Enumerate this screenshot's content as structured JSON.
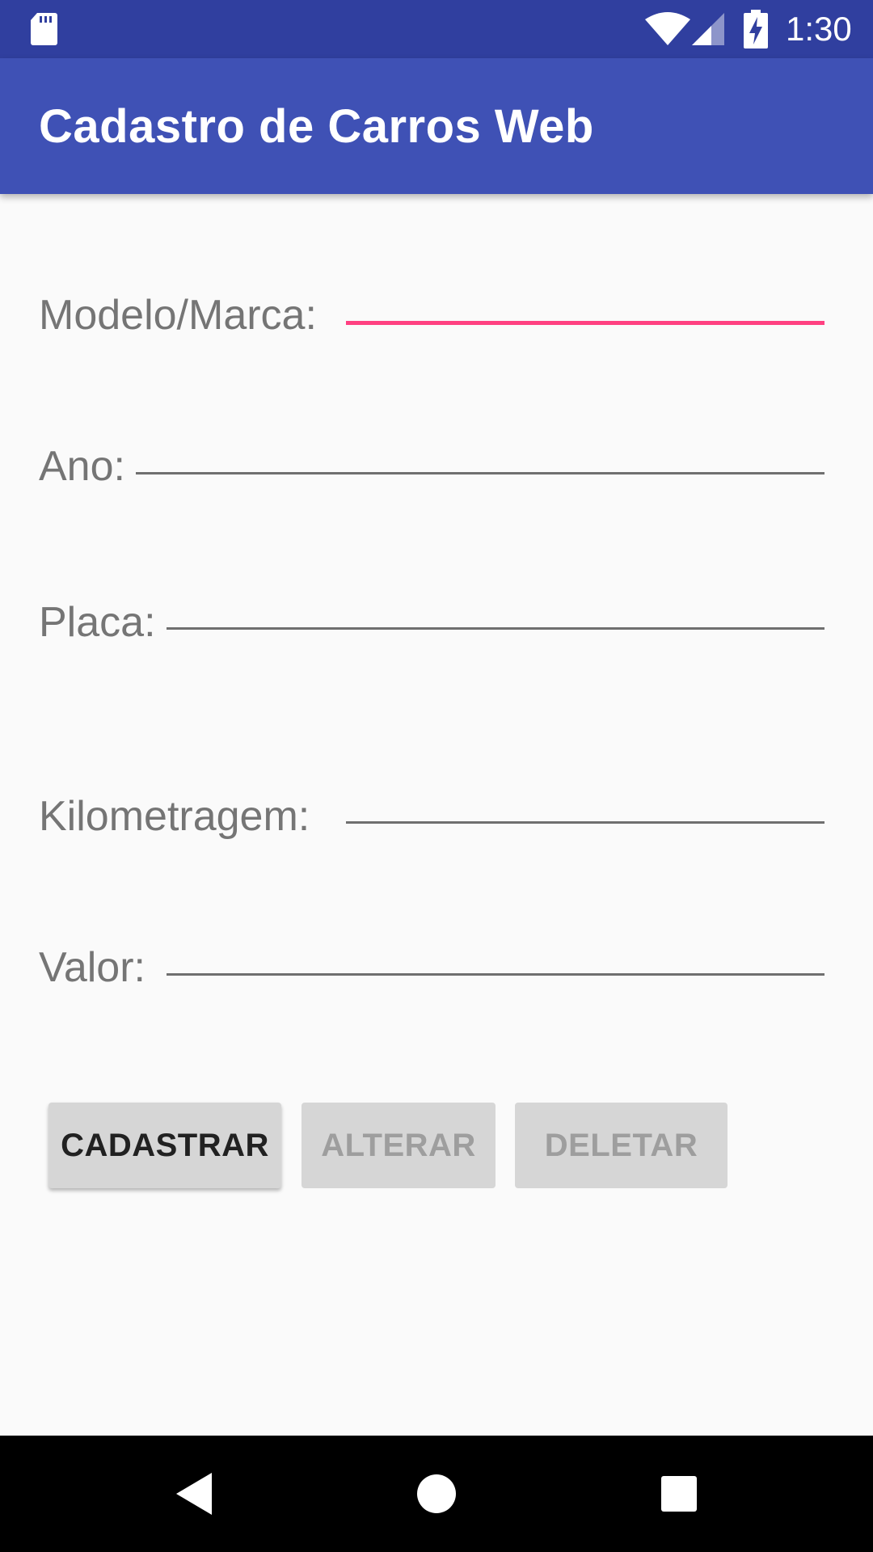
{
  "status_bar": {
    "time": "1:30",
    "icons": [
      "sd-card-icon",
      "wifi-icon",
      "cell-signal-icon",
      "battery-charging-icon"
    ]
  },
  "app_bar": {
    "title": "Cadastro de Carros Web"
  },
  "form": {
    "modelo_label": "Modelo/Marca:",
    "modelo_value": "",
    "ano_label": "Ano:",
    "ano_value": "",
    "placa_label": "Placa:",
    "placa_value": "",
    "km_label": "Kilometragem:",
    "km_value": "",
    "valor_label": "Valor:",
    "valor_value": ""
  },
  "buttons": {
    "cadastrar": "CADASTRAR",
    "alterar": "ALTERAR",
    "deletar": "DELETAR"
  },
  "colors": {
    "status_bar": "#303f9f",
    "app_bar": "#3f51b5",
    "accent_focus": "#ff4081",
    "background": "#fafafa"
  },
  "nav_bar": {
    "icons": [
      "back-icon",
      "home-icon",
      "recents-icon"
    ]
  }
}
